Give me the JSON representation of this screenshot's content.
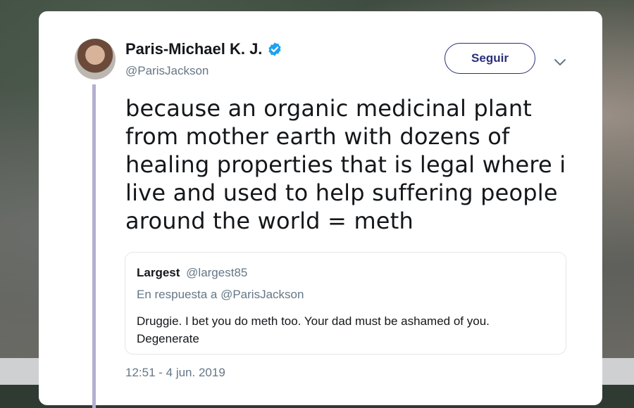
{
  "tweet": {
    "author_name": "Paris-Michael K. J.",
    "author_handle": "@ParisJackson",
    "verified_icon": "verified-badge-icon",
    "follow_label": "Seguir",
    "more_icon": "chevron-down-icon",
    "text": "because an organic medicinal plant from mother earth with dozens of healing properties that is legal where i live and used to help suffering people around the world = meth",
    "timestamp": "12:51 - 4 jun. 2019"
  },
  "quoted_tweet": {
    "author_name": "Largest",
    "author_handle": "@largest85",
    "reply_context": "En respuesta a @ParisJackson",
    "text": "Druggie. I bet you do meth too. Your dad must be ashamed of you. Degenerate"
  },
  "colors": {
    "verified_blue": "#1da1f2",
    "follow_button": "#2b2f7a",
    "thread_line": "#b3b0d0"
  }
}
